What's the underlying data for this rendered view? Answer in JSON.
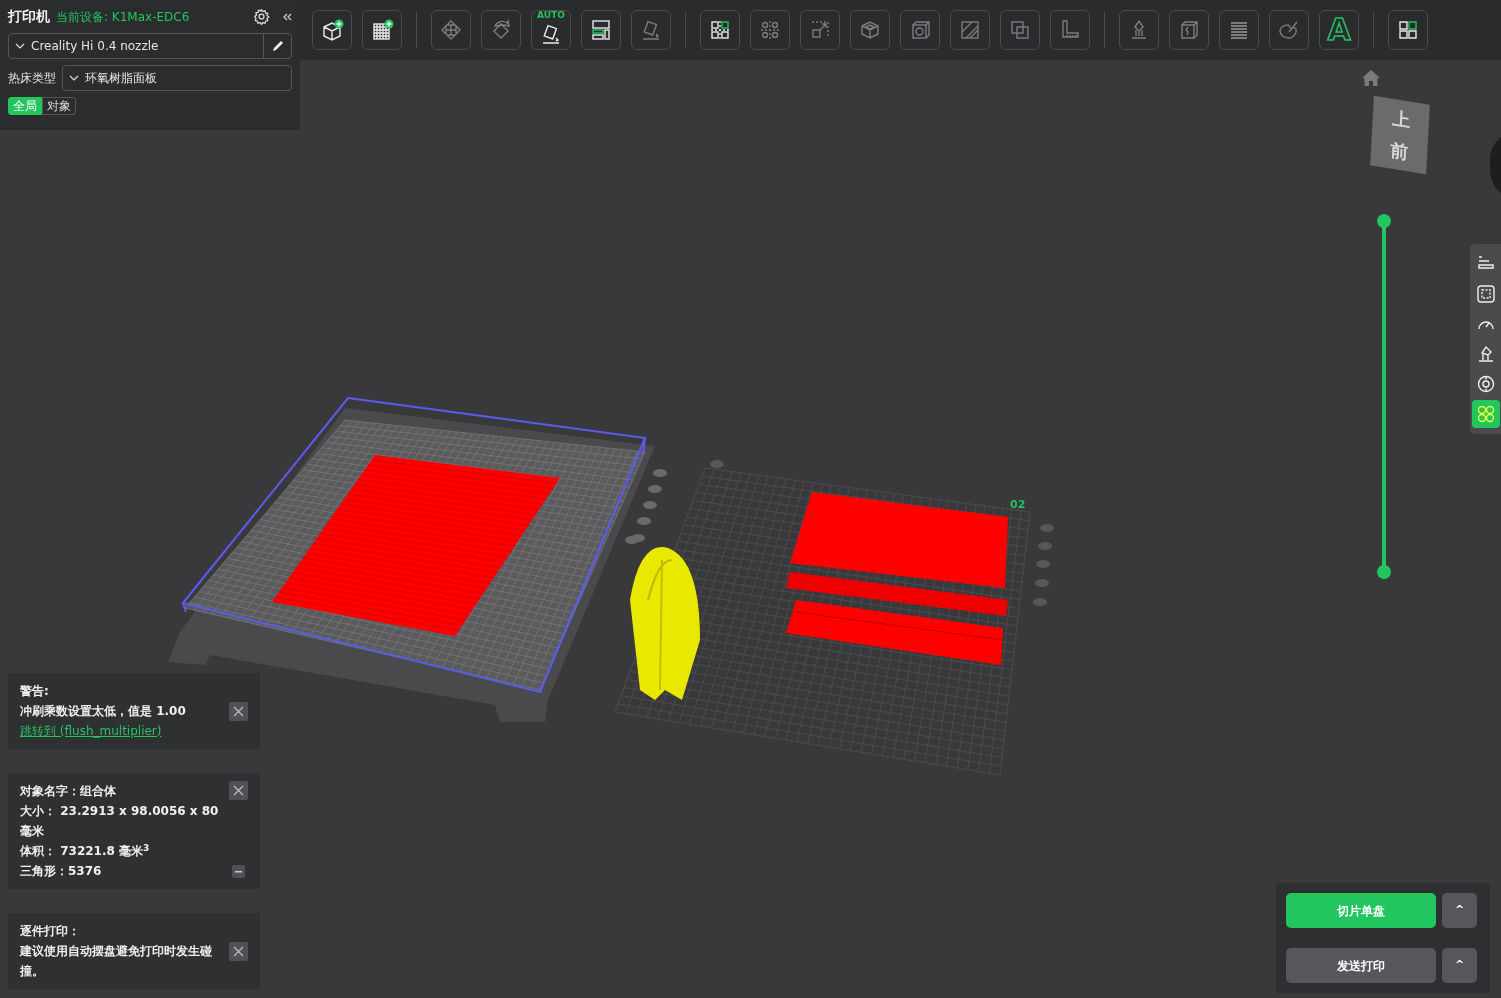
{
  "printer_panel": {
    "title": "打印机",
    "device": "当前设备: K1Max-EDC6",
    "printer": "Creality Hi 0.4 nozzle",
    "bed_type_label": "热床类型",
    "bed_type": "环氧树脂面板",
    "scope_tabs": [
      {
        "label": "全局",
        "selected": true
      },
      {
        "label": "对象",
        "selected": false
      }
    ]
  },
  "toolbar": {
    "groups": [
      [
        {
          "disabled": false
        },
        {
          "disabled": false
        }
      ],
      [
        {
          "disabled": true
        },
        {
          "disabled": true
        },
        {
          "disabled": false,
          "badge": "AUTO"
        },
        {
          "disabled": false
        },
        {
          "disabled": true
        }
      ],
      [
        {
          "disabled": false
        },
        {
          "disabled": true
        },
        {
          "disabled": true
        },
        {
          "disabled": true
        },
        {
          "disabled": true
        },
        {
          "disabled": true
        },
        {
          "disabled": true
        },
        {
          "disabled": true
        }
      ],
      [
        {
          "disabled": true
        },
        {
          "disabled": true
        },
        {
          "disabled": true
        },
        {
          "disabled": true
        },
        {
          "disabled": false,
          "label": "A"
        }
      ],
      [
        {
          "disabled": false
        }
      ]
    ]
  },
  "viewport": {
    "plate_label": "02",
    "view_cube": {
      "top": "上",
      "front": "前"
    }
  },
  "layer_slider": {
    "thumbs": [
      {
        "level": 1
      },
      {
        "level": 0
      }
    ]
  },
  "side_tools": [
    {
      "selected": false
    },
    {
      "selected": false
    },
    {
      "selected": false
    },
    {
      "selected": false
    },
    {
      "selected": false
    },
    {
      "selected": true
    }
  ],
  "notifications": [
    {
      "title": "警告:",
      "lines": [
        "冲刷乘数设置太低，值是 1.00"
      ],
      "link": "跳转到 (flush_multiplier)"
    },
    {
      "lines": [
        "对象名字：组合体",
        "大小：  23.2913 x 98.0056 x 80 毫米",
        "体积：  73221.8 毫米$^{3}$",
        "三角形：5376"
      ],
      "minimizable": true
    },
    {
      "title": "逐件打印：",
      "lines": [
        "建议使用自动摆盘避免打印时发生碰撞。"
      ]
    }
  ],
  "actions": [
    {
      "label": "切片单盘",
      "kind": "primary",
      "menu": "^"
    },
    {
      "label": "发送打印",
      "kind": "secondary",
      "menu": "^"
    }
  ]
}
